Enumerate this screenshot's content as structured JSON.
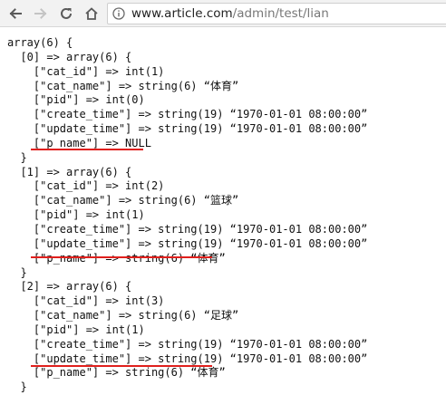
{
  "browser": {
    "url_host": "www.article.com",
    "url_path": "/admin/test/lian",
    "icons": {
      "back": "arrow-left-icon",
      "forward": "arrow-right-icon",
      "reload": "reload-icon",
      "home": "home-icon",
      "info": "info-icon"
    }
  },
  "dump": {
    "lines": [
      "array(6) {",
      "  [0] => array(6) {",
      "    [\"cat_id\"] => int(1)",
      "    [\"cat_name\"] => string(6) “体育”",
      "    [\"pid\"] => int(0)",
      "    [\"create_time\"] => string(19) “1970-01-01 08:00:00”",
      "    [\"update_time\"] => string(19) “1970-01-01 08:00:00”",
      "    [\"p_name\"] => NULL",
      "  }",
      "  [1] => array(6) {",
      "    [\"cat_id\"] => int(2)",
      "    [\"cat_name\"] => string(6) “篮球”",
      "    [\"pid\"] => int(1)",
      "    [\"create_time\"] => string(19) “1970-01-01 08:00:00”",
      "    [\"update_time\"] => string(19) “1970-01-01 08:00:00”",
      "    [\"p_name\"] => string(6) “体育”",
      "  }",
      "  [2] => array(6) {",
      "    [\"cat_id\"] => int(3)",
      "    [\"cat_name\"] => string(6) “足球”",
      "    [\"pid\"] => int(1)",
      "    [\"create_time\"] => string(19) “1970-01-01 08:00:00”",
      "    [\"update_time\"] => string(19) “1970-01-01 08:00:00”",
      "    [\"p_name\"] => string(6) “体育”",
      "  }"
    ]
  },
  "annotations": {
    "underline_color": "#e0201d"
  }
}
